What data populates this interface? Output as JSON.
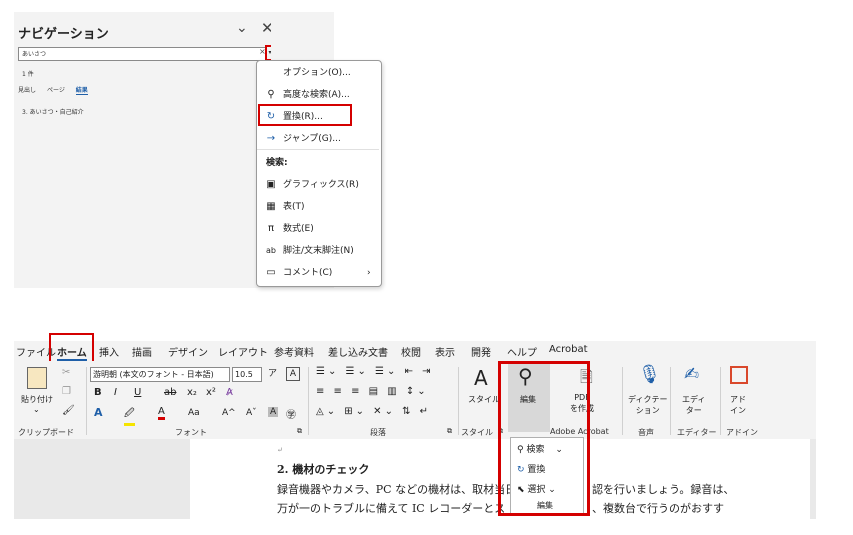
{
  "nav_pane": {
    "title": "ナビゲーション",
    "chevron_icon": "⌄",
    "close_icon": "✕",
    "search_value": "あいさつ",
    "clear_icon": "×",
    "dropdown_icon": "▾",
    "result_count": "1 件",
    "tabs": [
      "見出し",
      "ページ",
      "結果"
    ],
    "result_item": "3. あいさつ・自己紹介"
  },
  "search_menu": {
    "options": "オプション(O)...",
    "advanced_find": "高度な検索(A)...",
    "replace": "置換(R)...",
    "goto": "ジャンプ(G)...",
    "search_header": "検索:",
    "graphics": "グラフィックス(R)",
    "tables": "表(T)",
    "equations": "数式(E)",
    "footnotes": "脚注/文末脚注(N)",
    "comments": "コメント(C)",
    "icons": {
      "options": "",
      "advanced_find": "⚲",
      "replace": "↻",
      "goto": "→",
      "graphics": "▣",
      "tables": "▦",
      "equations": "π",
      "footnotes": "ab",
      "comments": "▭",
      "submenu": "›"
    }
  },
  "ribbon_tabs": [
    "ファイル",
    "ホーム",
    "挿入",
    "描画",
    "デザイン",
    "レイアウト",
    "参考資料",
    "差し込み文書",
    "校閲",
    "表示",
    "開発",
    "ヘルプ",
    "Acrobat"
  ],
  "ribbon": {
    "paste_label": "貼り付け",
    "paste_chevron": "⌄",
    "font_name": "游明朝 (本文のフォント - 日本語)",
    "font_size": "10.5",
    "bold": "B",
    "italic": "I",
    "underline": "U",
    "strike": "ab",
    "subscript": "x₂",
    "superscript": "x²",
    "text_effect": "A",
    "highlight": "🖉",
    "font_color": "A",
    "change_case": "Aa",
    "grow_font": "A^",
    "shrink_font": "Aˇ",
    "char_shade": "A",
    "enclose": "㊫",
    "styles_label": "スタイル",
    "edit_label": "編集",
    "pdf_label": "PDF\nを作成",
    "dictate_label": "ディクテー\nション",
    "editor_label": "エディ\nター",
    "addin_label": "アド\nイン",
    "groups": {
      "clipboard": "クリップボード",
      "font": "フォント",
      "paragraph": "段落",
      "styles": "スタイル",
      "acrobat": "Adobe Acrobat",
      "voice": "音声",
      "editor": "エディター",
      "addin": "アドイン"
    },
    "accent_color": "#1f5fa8",
    "highlight_color": "#f5e400",
    "font_color_value": "#d40000"
  },
  "edit_dropdown": {
    "find": "検索",
    "replace": "置換",
    "select": "選択",
    "group": "編集",
    "find_chevron": "⌄",
    "select_chevron": "⌄"
  },
  "document": {
    "paragraph_mark": "↵",
    "heading": "2.  機材のチェック",
    "line1": "録音機器やカメラ、PC などの機材は、取材当日",
    "line1_end": "認を行いましょう。録音は、",
    "line2": "万が一のトラブルに備えて IC レコーダーとス",
    "line2_end": "、複数台で行うのがおすす"
  }
}
